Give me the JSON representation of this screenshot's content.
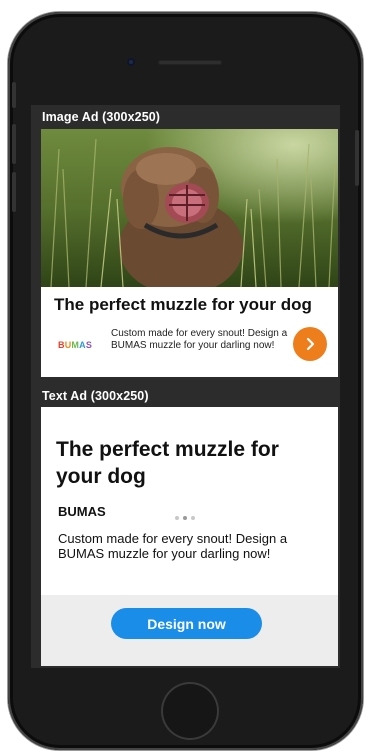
{
  "device": {
    "type": "smartphone mockup"
  },
  "image_ad": {
    "label": "Image Ad (300x250)",
    "headline": "The perfect muzzle for your dog",
    "brand_logo_text": "BUMAS",
    "body": "Custom made for every snout! Design a BUMAS muzzle for your darling now!",
    "cta_icon": "chevron-right-icon",
    "cta_color": "#ee7d1b"
  },
  "text_ad": {
    "label": "Text Ad (300x250)",
    "headline": "The perfect muzzle for your dog",
    "brand": "BUMAS",
    "pager": {
      "count": 3,
      "active": 1
    },
    "body": "Custom made for every snout! Design a BUMAS muzzle for your darling now!",
    "cta_label": "Design now",
    "cta_color": "#1a8de9"
  }
}
